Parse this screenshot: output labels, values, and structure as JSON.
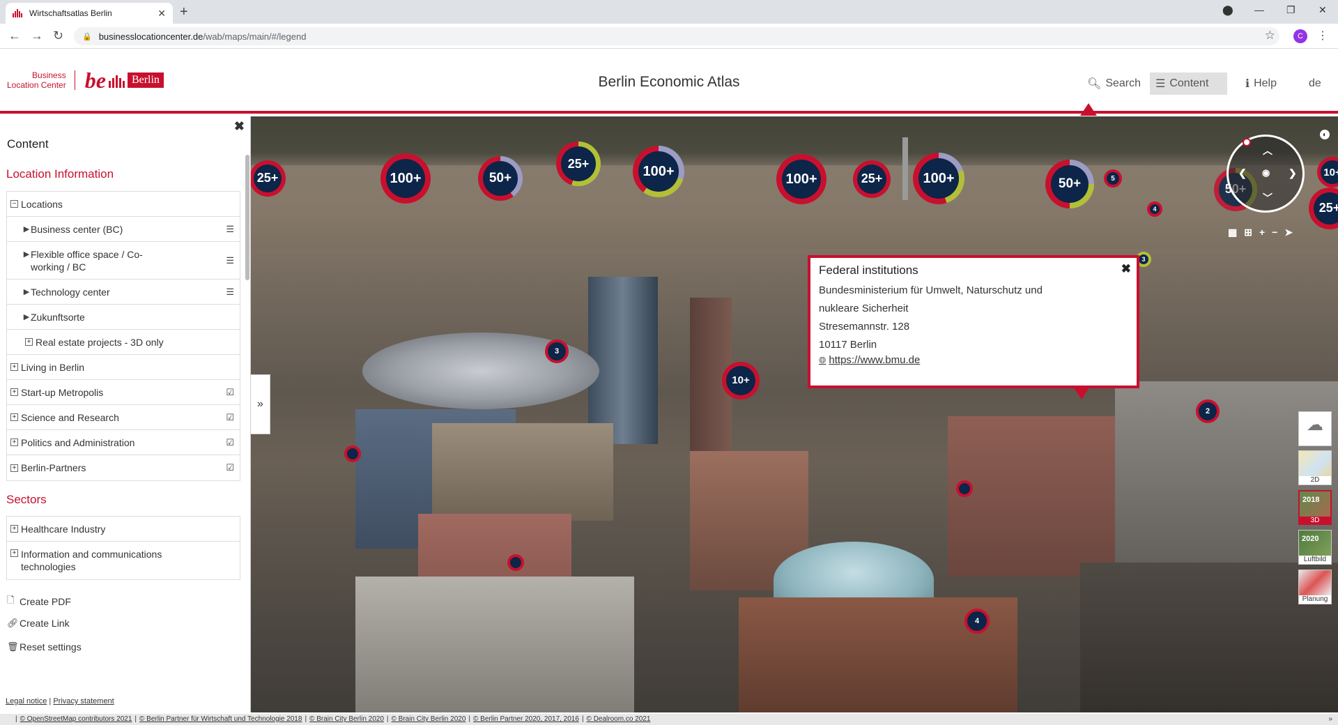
{
  "browser": {
    "tab_title": "Wirtschaftsatlas Berlin",
    "url_host": "businesslocationcenter.de",
    "url_path": "/wab/maps/main/#/legend",
    "profile_initial": "C"
  },
  "header": {
    "logo_line1": "Business",
    "logo_line2": "Location Center",
    "logo_be": "be",
    "logo_berlin": "Berlin",
    "title": "Berlin Economic Atlas",
    "search_label": "Search",
    "content_label": "Content",
    "help_label": "Help",
    "lang_label": "de"
  },
  "sidebar": {
    "title": "Content",
    "section1": "Location Information",
    "section2": "Sectors",
    "locations": {
      "label": "Locations",
      "children": [
        {
          "label": "Business center (BC)"
        },
        {
          "label": "Flexible office space / Co-working / BC"
        },
        {
          "label": "Technology center"
        },
        {
          "label": "Zukunftsorte"
        },
        {
          "label": "Real estate projects - 3D only"
        }
      ]
    },
    "categories": [
      {
        "label": "Living in Berlin"
      },
      {
        "label": "Start-up Metropolis"
      },
      {
        "label": "Science and Research"
      },
      {
        "label": "Politics and Administration"
      },
      {
        "label": "Berlin-Partners"
      }
    ],
    "sectors": [
      {
        "label": "Healthcare Industry"
      },
      {
        "label": "Information and communications technologies"
      }
    ],
    "actions": {
      "create_pdf": "Create PDF",
      "create_link": "Create Link",
      "reset": "Reset settings"
    },
    "footer": {
      "legal": "Legal notice",
      "privacy": "Privacy statement"
    }
  },
  "map": {
    "clusters": [
      {
        "label": "25+"
      },
      {
        "label": "100+"
      },
      {
        "label": "50+"
      },
      {
        "label": "25+"
      },
      {
        "label": "100+"
      },
      {
        "label": "100+"
      },
      {
        "label": "25+"
      },
      {
        "label": "100+"
      },
      {
        "label": "50+"
      },
      {
        "label": "5"
      },
      {
        "label": "4"
      },
      {
        "label": "50+"
      },
      {
        "label": "10+"
      },
      {
        "label": "25+"
      },
      {
        "label": "3"
      },
      {
        "label": "3"
      },
      {
        "label": "10+"
      },
      {
        "label": "2"
      },
      {
        "label": "4"
      }
    ],
    "popup": {
      "title": "Federal institutions",
      "line1": "Bundesministerium für Umwelt, Naturschutz und",
      "line2": "nukleare Sicherheit",
      "street": "Stresemannstr. 128",
      "city": "10117 Berlin",
      "link": "https://www.bmu.de"
    },
    "basemaps": [
      {
        "caption": "",
        "year": ""
      },
      {
        "caption": "2D",
        "year": ""
      },
      {
        "caption": "3D",
        "year": "2018"
      },
      {
        "caption": "Luftbild",
        "year": "2020"
      },
      {
        "caption": "Planung",
        "year": ""
      }
    ]
  },
  "attribution": [
    "© OpenStreetMap contributors 2021",
    "© Berlin Partner für Wirtschaft und Technologie 2018",
    "© Brain City Berlin 2020",
    "© Brain City Berlin 2020",
    "© Berlin Partner 2020, 2017, 2016",
    "© Dealroom.co 2021"
  ],
  "colors": {
    "accent": "#c8102e",
    "cluster_fill": "#0c2548"
  }
}
